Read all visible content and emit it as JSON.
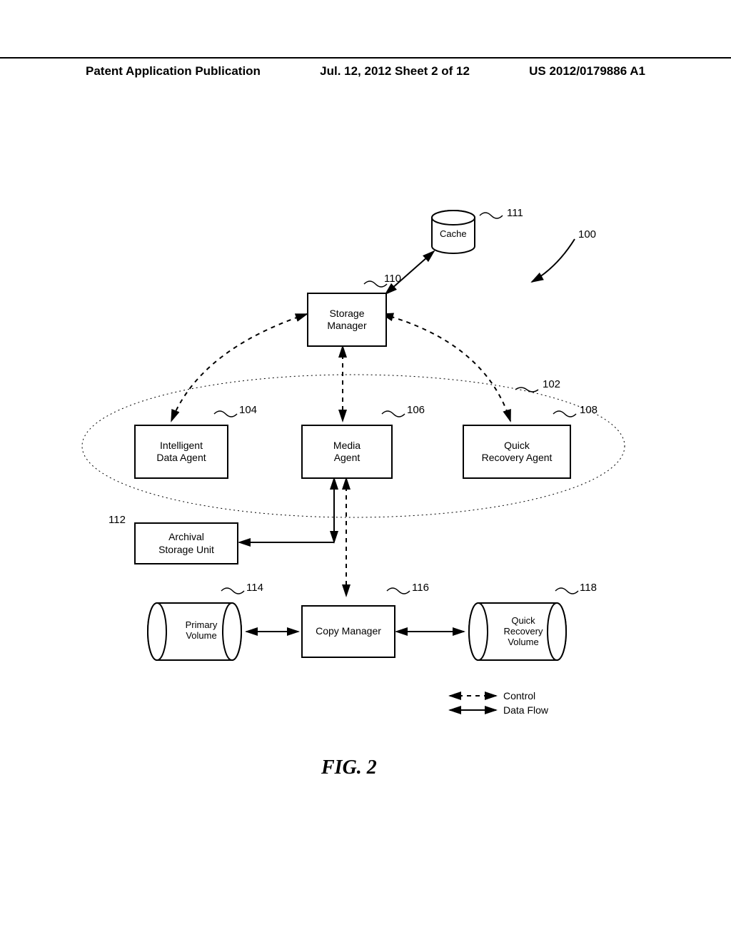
{
  "header": {
    "left": "Patent Application Publication",
    "mid": "Jul. 12, 2012  Sheet 2 of 12",
    "right": "US 2012/0179886 A1"
  },
  "refs": {
    "r100": "100",
    "r102": "102",
    "r104": "104",
    "r106": "106",
    "r108": "108",
    "r110": "110",
    "r111": "111",
    "r112": "112",
    "r114": "114",
    "r116": "116",
    "r118": "118"
  },
  "boxes": {
    "cache": "Cache",
    "storage_manager": "Storage\nManager",
    "ida": "Intelligent\nData Agent",
    "media_agent": "Media\nAgent",
    "qra": "Quick\nRecovery Agent",
    "archival": "Archival\nStorage Unit",
    "primary_volume": "Primary\nVolume",
    "copy_manager": "Copy Manager",
    "qr_volume": "Quick\nRecovery\nVolume"
  },
  "legend": {
    "control": "Control",
    "data_flow": "Data Flow"
  },
  "figure_label": "FIG. 2"
}
